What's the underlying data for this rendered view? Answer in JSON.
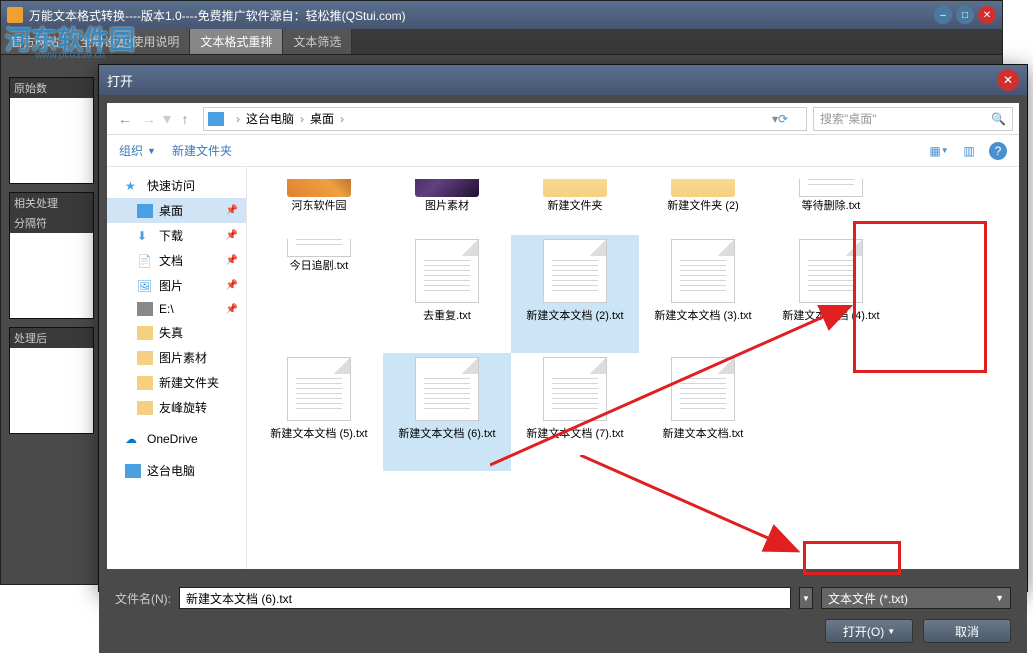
{
  "bgWindow": {
    "title": "万能文本格式转换----版本1.0----免费推广软件源自：轻松推(QStui.com)"
  },
  "watermark": {
    "main": "河东软件园",
    "sub": "www.pc0359.cn"
  },
  "tabs": [
    "官方网站",
    "全局设置/使用说明",
    "文本格式重排",
    "文本筛选"
  ],
  "side": {
    "l1": "原始数",
    "l2": "相关处理",
    "l3": "分隔符",
    "l4": "处理后"
  },
  "dialog": {
    "title": "打开",
    "nav": {
      "pc": "这台电脑",
      "desktop": "桌面"
    },
    "searchPlaceholder": "搜索\"桌面\"",
    "toolbar": {
      "org": "组织",
      "newFolder": "新建文件夹"
    },
    "sidebar": {
      "quick": "快速访问",
      "desktop": "桌面",
      "downloads": "下载",
      "docs": "文档",
      "pics": "图片",
      "e": "E:\\",
      "lost": "失真",
      "picmat": "图片素材",
      "newf": "新建文件夹",
      "youfeng": "友峰旋转",
      "onedrive": "OneDrive",
      "thispc": "这台电脑"
    },
    "files": [
      {
        "name": "河东软件园",
        "type": "folder-thumb1"
      },
      {
        "name": "图片素材",
        "type": "folder-thumb2"
      },
      {
        "name": "新建文件夹",
        "type": "folder"
      },
      {
        "name": "新建文件夹 (2)",
        "type": "folder"
      },
      {
        "name": "等待删除.txt",
        "type": "txt"
      },
      {
        "name": "今日追剧.txt",
        "type": "txt"
      },
      {
        "name": "去重复.txt",
        "type": "txt"
      },
      {
        "name": "新建文本文档 (2).txt",
        "type": "txt",
        "sel": true
      },
      {
        "name": "新建文本文档 (3).txt",
        "type": "txt"
      },
      {
        "name": "新建文本文档 (4).txt",
        "type": "txt"
      },
      {
        "name": "新建文本文档 (5).txt",
        "type": "txt"
      },
      {
        "name": "新建文本文档 (6).txt",
        "type": "txt",
        "sel": true
      },
      {
        "name": "新建文本文档 (7).txt",
        "type": "txt"
      },
      {
        "name": "新建文本文档.txt",
        "type": "txt"
      }
    ],
    "fnLabel": "文件名(N):",
    "fnValue": "新建文本文档 (6).txt",
    "fileType": "文本文件 (*.txt)",
    "openBtn": "打开(O)",
    "cancelBtn": "取消"
  }
}
